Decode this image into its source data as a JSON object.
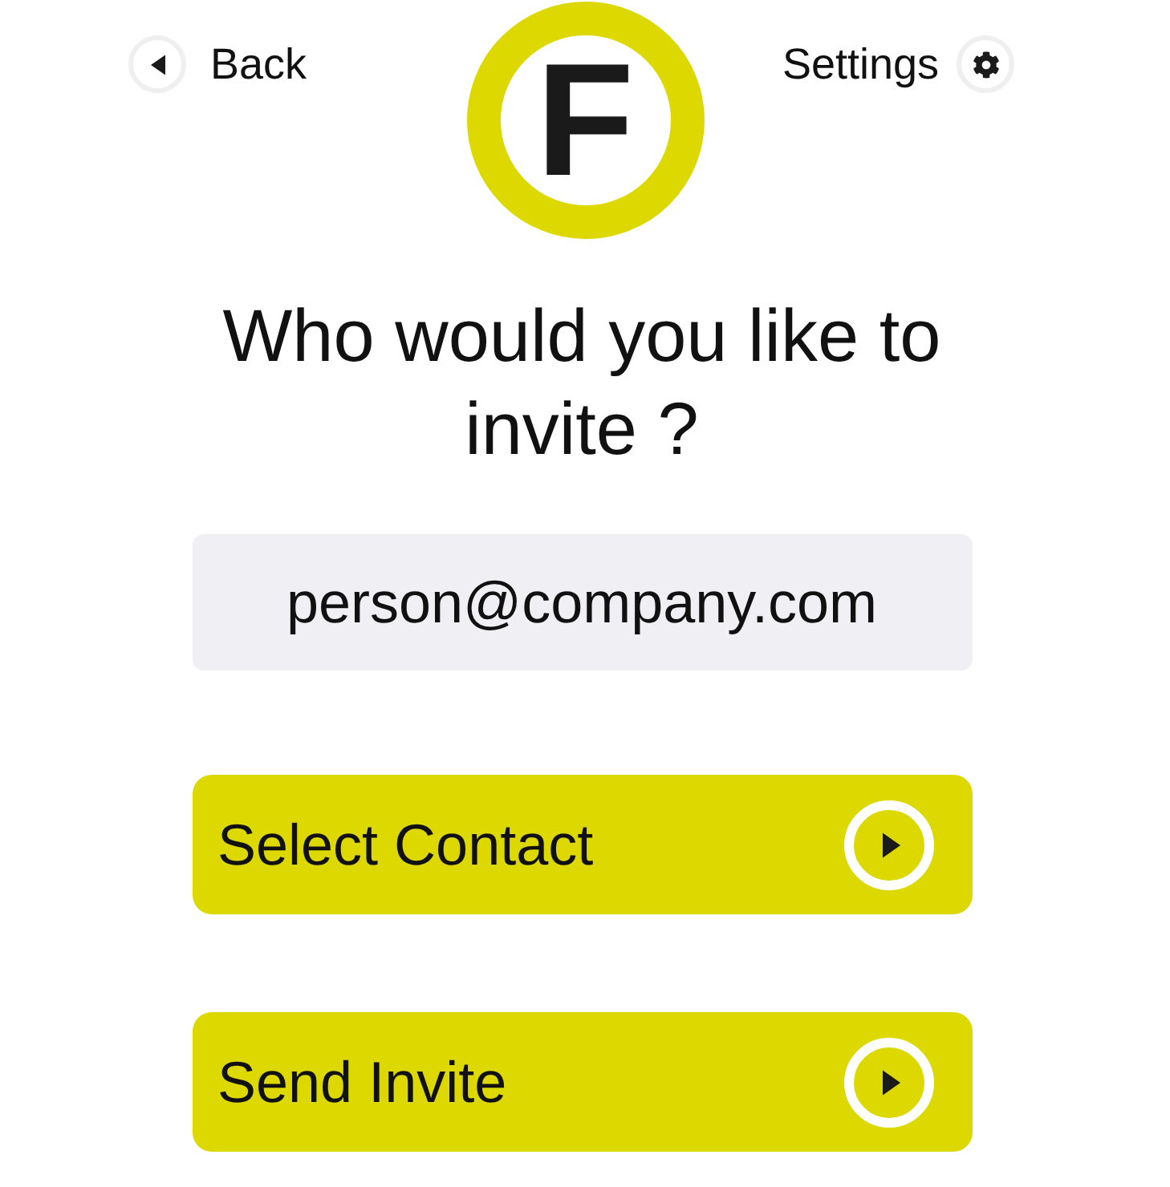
{
  "header": {
    "back": {
      "label": "Back"
    },
    "logo": {
      "letter": "F"
    },
    "settings": {
      "label": "Settings"
    }
  },
  "title": "Who would you like to invite ?",
  "email_field": {
    "value": "person@company.com"
  },
  "buttons": [
    {
      "label": "Select Contact"
    },
    {
      "label": "Send Invite"
    }
  ]
}
